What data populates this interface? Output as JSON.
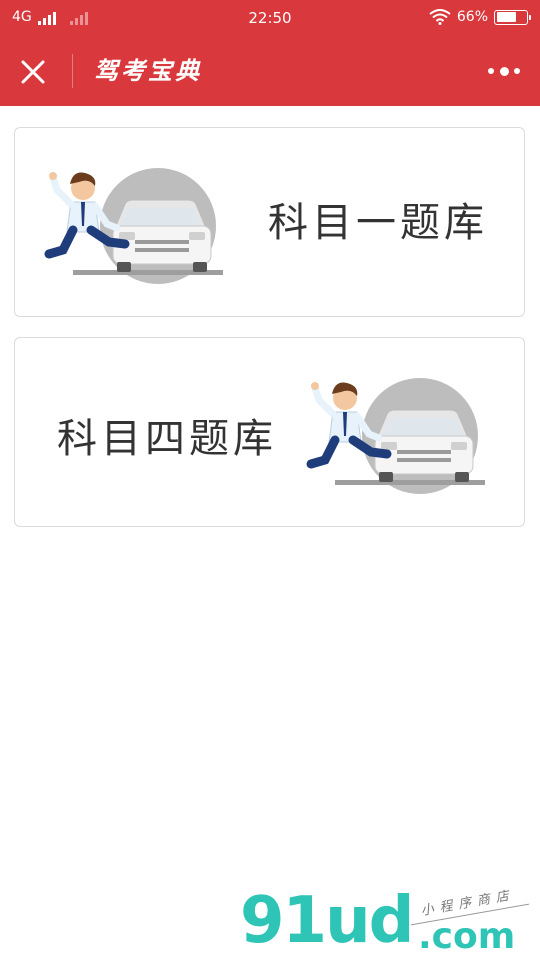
{
  "status_bar": {
    "network": "4G",
    "time": "22:50",
    "battery_percent": "66%",
    "battery_level": 0.66
  },
  "nav": {
    "title": "驾考宝典"
  },
  "cards": [
    {
      "label": "科目一题库"
    },
    {
      "label": "科目四题库"
    }
  ],
  "watermark": {
    "brand": "91ud",
    "domain": ".com",
    "tagline": "小程序商店"
  },
  "colors": {
    "brand_red": "#d9393d",
    "text_dark": "#333333",
    "card_border": "#dcdcdc"
  },
  "icons": {
    "close": "close-icon",
    "more": "more-dots-icon",
    "wifi": "wifi-icon",
    "signal": "signal-icon",
    "battery": "battery-icon"
  }
}
